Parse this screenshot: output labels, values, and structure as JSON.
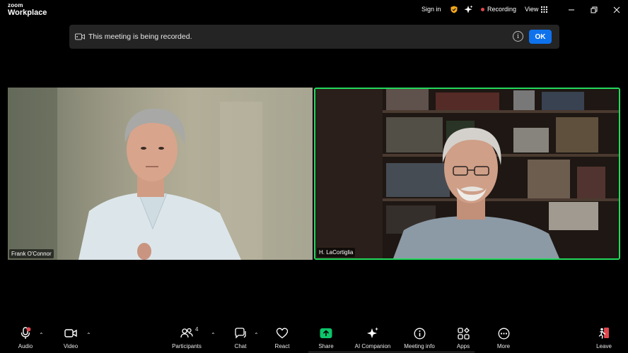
{
  "app": {
    "logo_line1": "zoom",
    "logo_line2": "Workplace"
  },
  "titlebar": {
    "sign_in": "Sign in",
    "recording": "Recording",
    "view": "View"
  },
  "banner": {
    "message": "This meeting is being recorded.",
    "info": "i",
    "ok": "OK"
  },
  "participants": [
    {
      "name": "Frank O'Connor"
    },
    {
      "name": "H. LaCortiglia"
    }
  ],
  "toolbar": {
    "audio": "Audio",
    "video": "Video",
    "participants": "Participants",
    "participants_count": "4",
    "chat": "Chat",
    "react": "React",
    "share": "Share",
    "ai_companion": "AI Companion",
    "meeting_info": "Meeting info",
    "apps": "Apps",
    "more": "More",
    "leave": "Leave"
  },
  "colors": {
    "accent": "#0e72ed",
    "active_speaker": "#23d95d",
    "share": "#0cc56b",
    "recording": "#e0484e"
  }
}
